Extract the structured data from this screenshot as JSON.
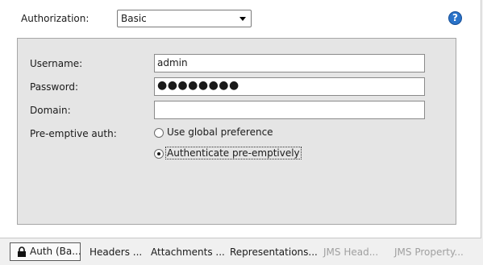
{
  "authorization": {
    "label": "Authorization:",
    "selected": "Basic",
    "help_icon": "help-icon"
  },
  "form": {
    "username_label": "Username:",
    "username_value": "admin",
    "password_label": "Password:",
    "password_value": "●●●●●●●●",
    "domain_label": "Domain:",
    "domain_value": "",
    "preemptive_label": "Pre-emptive auth:",
    "radio_options": [
      {
        "label": "Use global preference",
        "selected": false
      },
      {
        "label": "Authenticate pre-emptively",
        "selected": true
      }
    ]
  },
  "tabs": [
    {
      "label": "Auth (Ba...",
      "icon": "lock-icon",
      "active": true,
      "enabled": true
    },
    {
      "label": "Headers ...",
      "active": false,
      "enabled": true
    },
    {
      "label": "Attachments ...",
      "active": false,
      "enabled": true
    },
    {
      "label": "Representations...",
      "active": false,
      "enabled": true
    },
    {
      "label": "JMS Head...",
      "active": false,
      "enabled": false
    },
    {
      "label": "JMS Property...",
      "active": false,
      "enabled": false
    }
  ],
  "colors": {
    "panel_bg": "#ffffff",
    "group_bg": "#e5e5e5",
    "help_blue": "#2a73c9",
    "disabled_text": "#a0a0a0"
  }
}
